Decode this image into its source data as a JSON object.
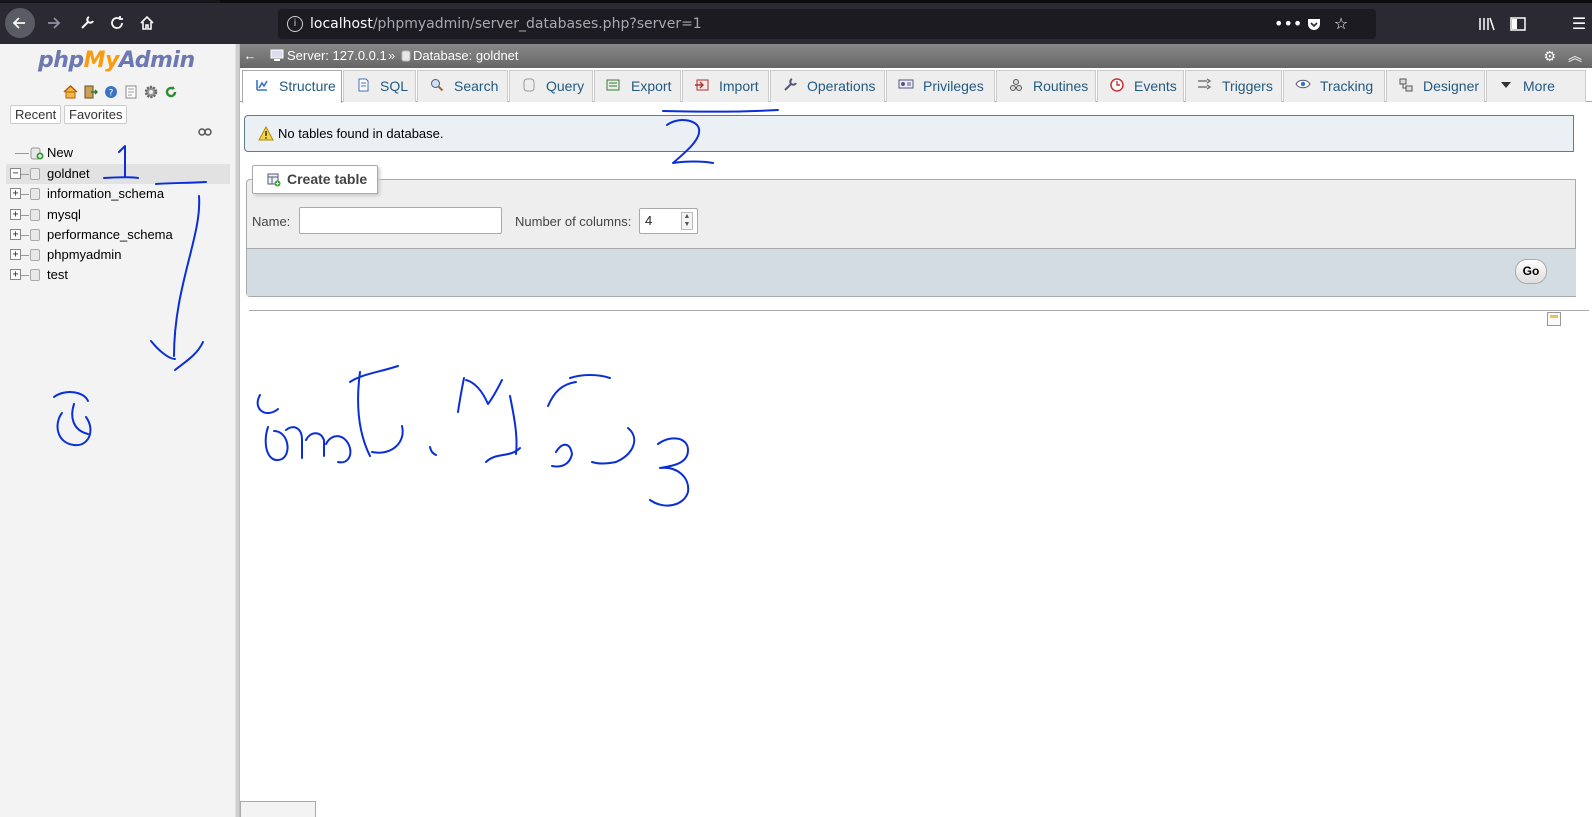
{
  "browser": {
    "url_host": "localhost",
    "url_path": "/phpmyadmin/server_databases.php?server=1"
  },
  "sidebar": {
    "logo": {
      "php": "php",
      "my": "My",
      "admin": "Admin"
    },
    "tabs": {
      "recent": "Recent",
      "favorites": "Favorites"
    },
    "tree": [
      {
        "label": "New",
        "expander": ""
      },
      {
        "label": "goldnet",
        "expander": "−"
      },
      {
        "label": "information_schema",
        "expander": "+"
      },
      {
        "label": "mysql",
        "expander": "+"
      },
      {
        "label": "performance_schema",
        "expander": "+"
      },
      {
        "label": "phpmyadmin",
        "expander": "+"
      },
      {
        "label": "test",
        "expander": "+"
      }
    ]
  },
  "breadcrumb": {
    "server": "Server: 127.0.0.1",
    "separator": "»",
    "database": "Database: goldnet"
  },
  "tabs": [
    {
      "label": "Structure",
      "icon": "structure-icon",
      "active": true
    },
    {
      "label": "SQL",
      "icon": "sql-icon"
    },
    {
      "label": "Search",
      "icon": "search-icon"
    },
    {
      "label": "Query",
      "icon": "query-icon"
    },
    {
      "label": "Export",
      "icon": "export-icon"
    },
    {
      "label": "Import",
      "icon": "import-icon"
    },
    {
      "label": "Operations",
      "icon": "wrench-icon"
    },
    {
      "label": "Privileges",
      "icon": "privileges-icon"
    },
    {
      "label": "Routines",
      "icon": "routines-icon"
    },
    {
      "label": "Events",
      "icon": "clock-icon"
    },
    {
      "label": "Triggers",
      "icon": "triggers-icon"
    },
    {
      "label": "Tracking",
      "icon": "eye-icon"
    },
    {
      "label": "Designer",
      "icon": "designer-icon"
    },
    {
      "label": "More",
      "icon": "caret-down-icon"
    }
  ],
  "notice": {
    "text": "No tables found in database."
  },
  "create_table": {
    "legend": "Create table",
    "name_label": "Name:",
    "name_value": "",
    "columns_label": "Number of columns:",
    "columns_value": "4",
    "go_label": "Go"
  },
  "annotations": {
    "mark_1": "1",
    "mark_2": "2",
    "mark_3": "3"
  },
  "colors": {
    "tab_text": "#235a81",
    "notice_bg": "#eaf0f4",
    "go_bar": "#d3dce3",
    "scribble": "#0a2fd6",
    "logo_blue": "#6c78af",
    "logo_orange": "#f89c0e"
  }
}
